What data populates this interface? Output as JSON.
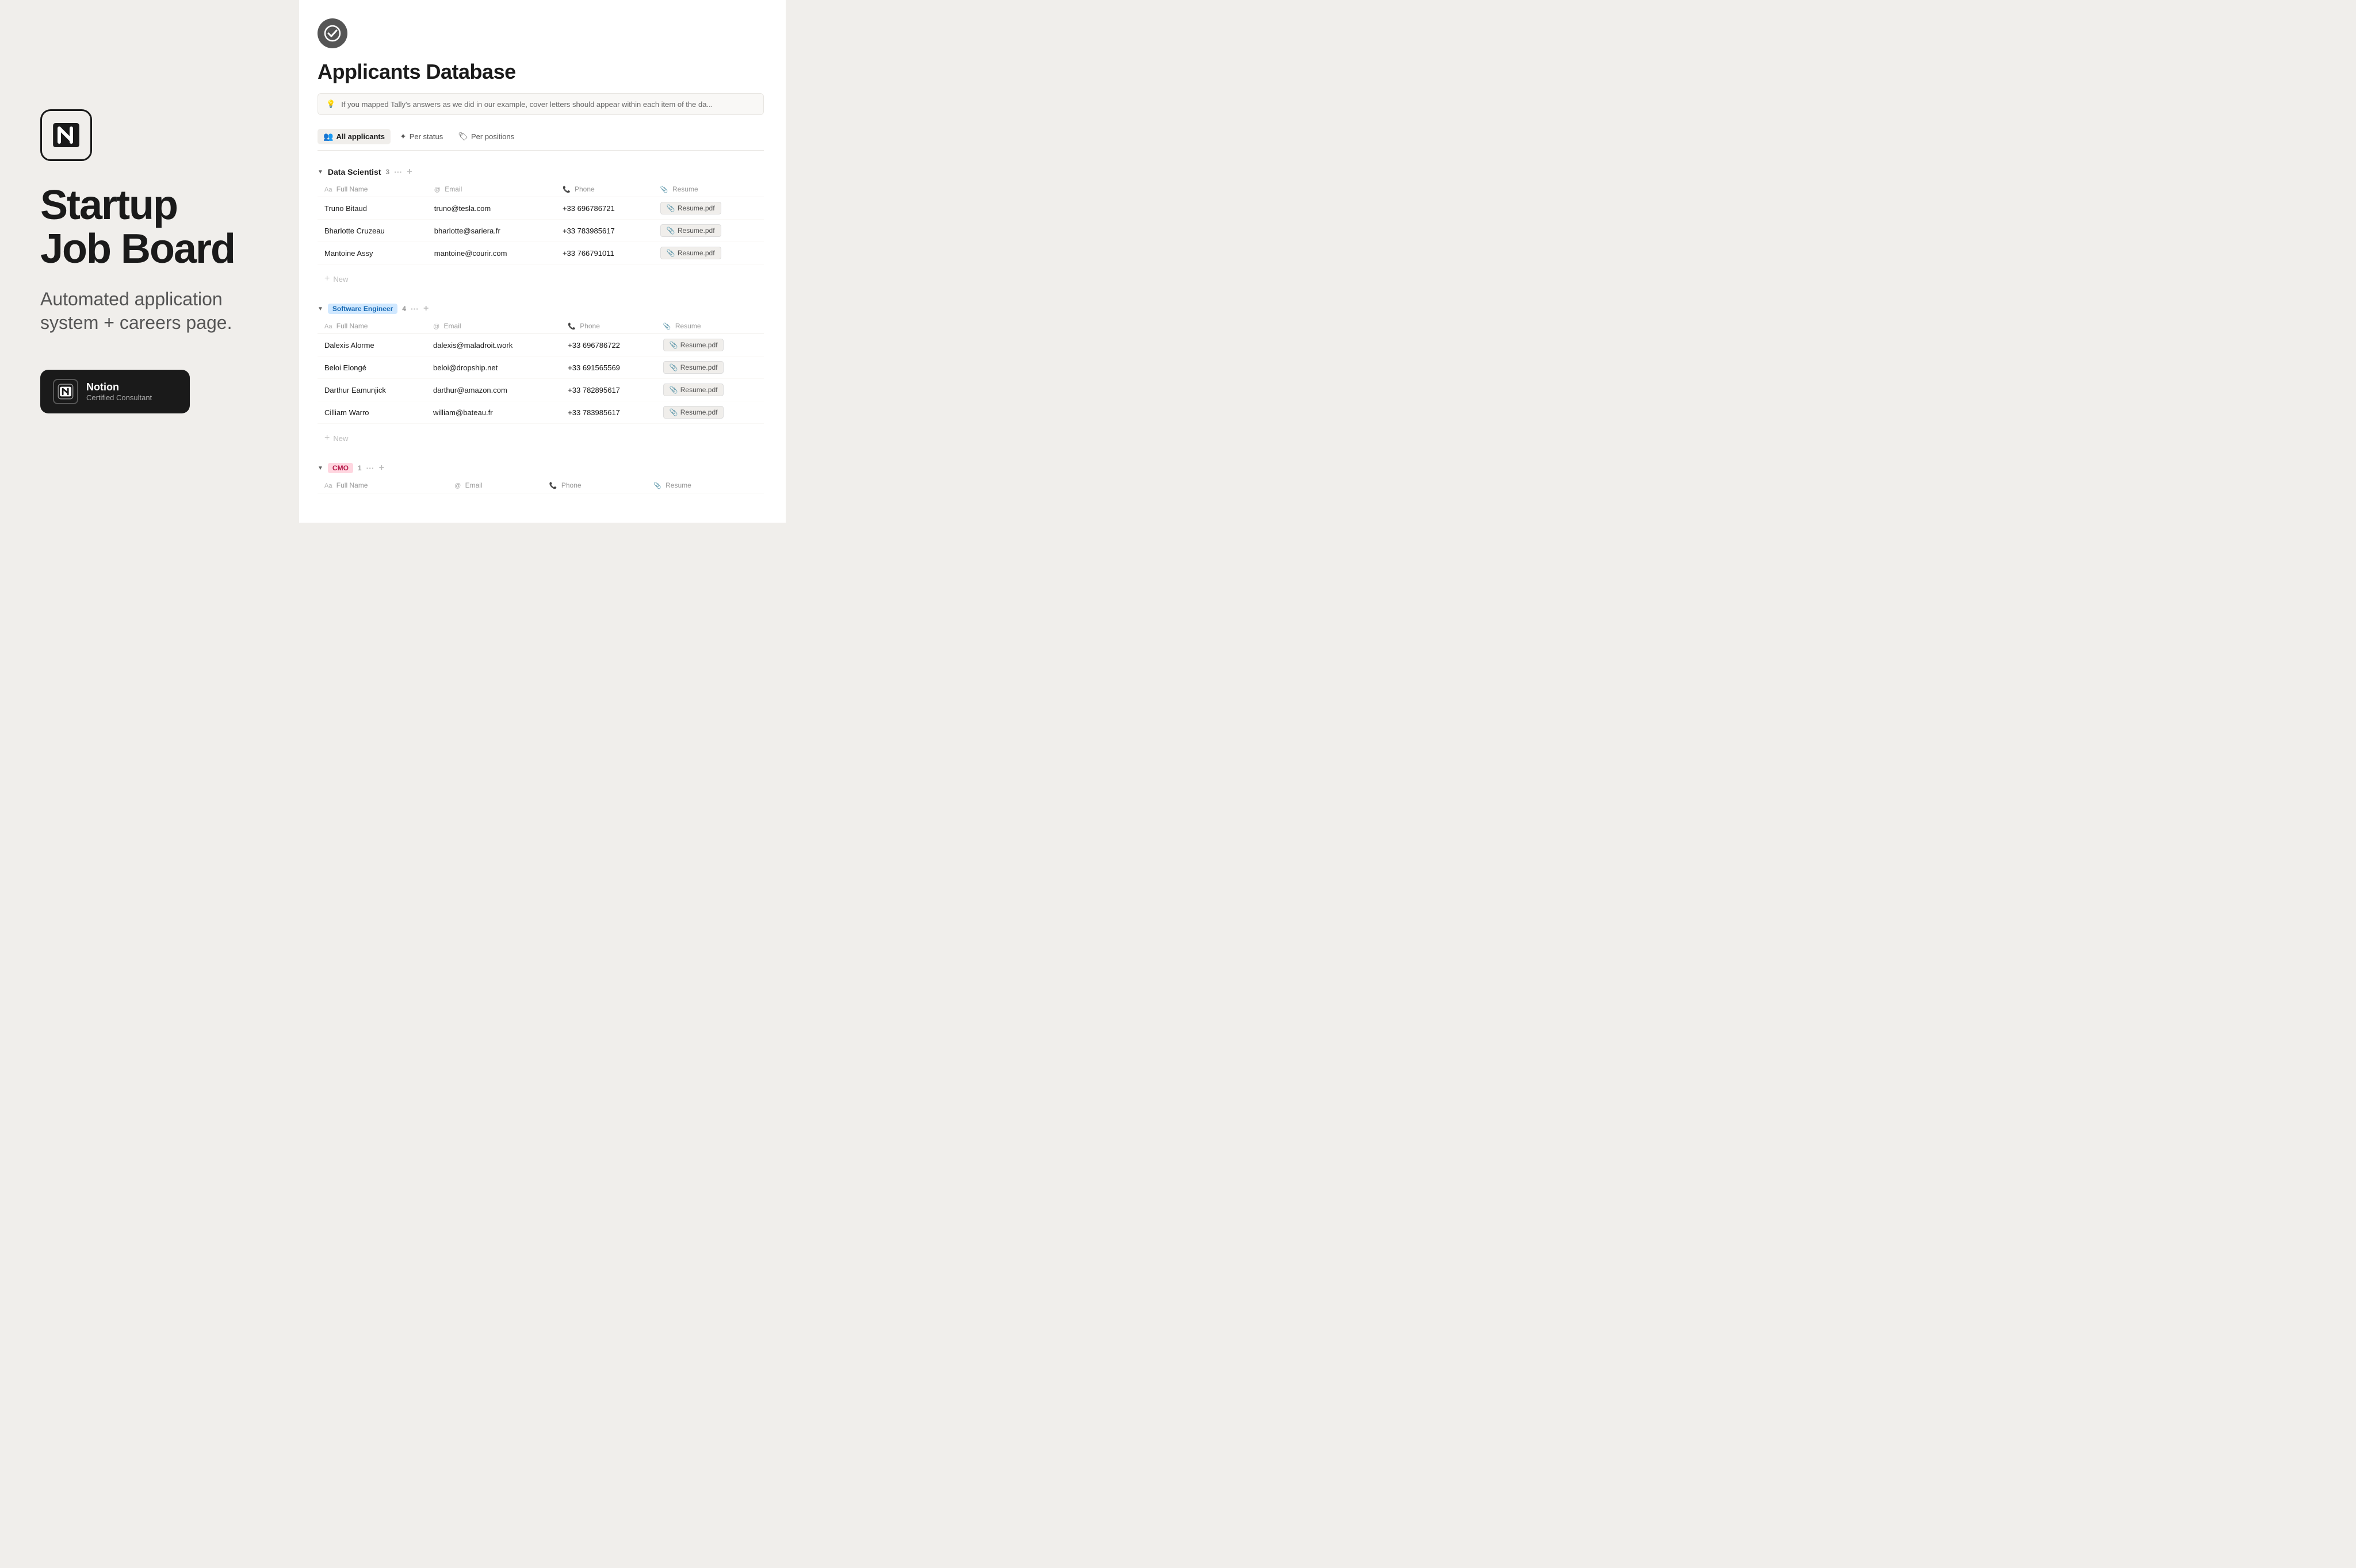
{
  "left": {
    "logo_alt": "Notion Logo",
    "title_line1": "Startup",
    "title_line2": "Job Board",
    "subtitle": "Automated application system + careers page.",
    "badge": {
      "notion": "Notion",
      "certified": "Certified Consultant"
    }
  },
  "right": {
    "db_title": "Applicants Database",
    "hint": "If you mapped Tally's answers as we did in our example, cover letters should appear within each item of the da...",
    "tabs": [
      {
        "label": "All applicants",
        "icon": "👥",
        "active": true
      },
      {
        "label": "Per status",
        "icon": "✦",
        "active": false
      },
      {
        "label": "Per positions",
        "icon": "🏷",
        "active": false
      }
    ],
    "sections": [
      {
        "name": "Data Scientist",
        "badge_type": "default",
        "count": "3",
        "columns": [
          "Full Name",
          "Email",
          "Phone",
          "Resume"
        ],
        "rows": [
          {
            "name": "Truno Bitaud",
            "email": "truno@tesla.com",
            "phone": "+33 696786721",
            "resume": "Resume.pdf"
          },
          {
            "name": "Bharlotte Cruzeau",
            "email": "bharlotte@sariera.fr",
            "phone": "+33 783985617",
            "resume": "Resume.pdf"
          },
          {
            "name": "Mantoine Assy",
            "email": "mantoine@courir.com",
            "phone": "+33 766791011",
            "resume": "Resume.pdf"
          }
        ]
      },
      {
        "name": "Software Engineer",
        "badge_type": "blue",
        "count": "4",
        "columns": [
          "Full Name",
          "Email",
          "Phone",
          "Resume"
        ],
        "rows": [
          {
            "name": "Dalexis Alorme",
            "email": "dalexis@maladroit.work",
            "phone": "+33 696786722",
            "resume": "Resume.pdf"
          },
          {
            "name": "Beloi Elongé",
            "email": "beloi@dropship.net",
            "phone": "+33 691565569",
            "resume": "Resume.pdf"
          },
          {
            "name": "Darthur Eamunjick",
            "email": "darthur@amazon.com",
            "phone": "+33 782895617",
            "resume": "Resume.pdf"
          },
          {
            "name": "Cilliam Warro",
            "email": "william@bateau.fr",
            "phone": "+33 783985617",
            "resume": "Resume.pdf"
          }
        ]
      },
      {
        "name": "CMO",
        "badge_type": "pink",
        "count": "1",
        "columns": [
          "Full Name",
          "Email",
          "Phone",
          "Resume"
        ],
        "rows": []
      }
    ]
  }
}
